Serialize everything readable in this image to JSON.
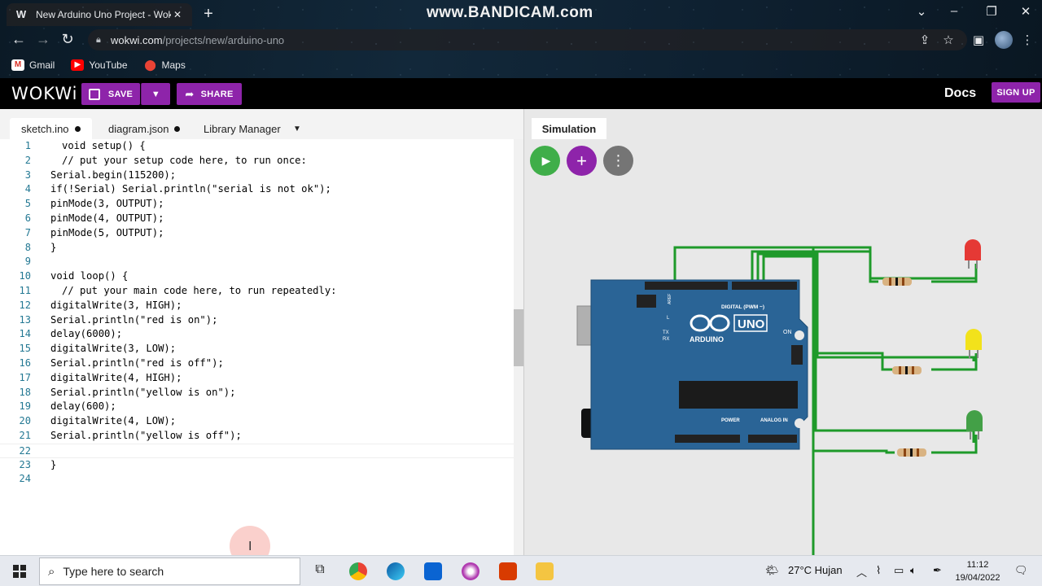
{
  "browser": {
    "tab_title": "New Arduino Uno Project - Wokwi",
    "tab_favicon": "W",
    "url_host": "wokwi.com",
    "url_path": "/projects/new/arduino-uno",
    "watermark": "www.BANDICAM.com",
    "bookmarks": [
      {
        "label": "Gmail",
        "icon": "gmail-icon",
        "color": "#d93025"
      },
      {
        "label": "YouTube",
        "icon": "youtube-icon",
        "color": "#ff0000"
      },
      {
        "label": "Maps",
        "icon": "maps-icon",
        "color": "#34a853"
      }
    ]
  },
  "wokwi": {
    "logo": "WOKWi",
    "save_label": "SAVE",
    "share_label": "SHARE",
    "docs_label": "Docs",
    "signup_label": "SIGN UP",
    "accent": "#8e24aa"
  },
  "editor": {
    "tabs": [
      {
        "label": "sketch.ino",
        "modified": true
      },
      {
        "label": "diagram.json",
        "modified": true
      },
      {
        "label": "Library Manager"
      }
    ],
    "lines": [
      {
        "n": "1",
        "text": "void setup() {",
        "indent": true
      },
      {
        "n": "2",
        "text": "// put your setup code here, to run once:",
        "indent": true
      },
      {
        "n": "3",
        "text": "Serial.begin(115200);"
      },
      {
        "n": "4",
        "text": "if(!Serial) Serial.println(\"serial is not ok\");"
      },
      {
        "n": "5",
        "text": "pinMode(3, OUTPUT);"
      },
      {
        "n": "6",
        "text": "pinMode(4, OUTPUT);"
      },
      {
        "n": "7",
        "text": "pinMode(5, OUTPUT);"
      },
      {
        "n": "8",
        "text": "}"
      },
      {
        "n": "9",
        "text": ""
      },
      {
        "n": "10",
        "text": "void loop() {"
      },
      {
        "n": "11",
        "text": "// put your main code here, to run repeatedly:",
        "indent": true
      },
      {
        "n": "12",
        "text": "digitalWrite(3, HIGH);"
      },
      {
        "n": "13",
        "text": "Serial.println(\"red is on\");"
      },
      {
        "n": "14",
        "text": "delay(6000);"
      },
      {
        "n": "15",
        "text": "digitalWrite(3, LOW);"
      },
      {
        "n": "16",
        "text": "Serial.println(\"red is off\");"
      },
      {
        "n": "17",
        "text": "digitalWrite(4, HIGH);"
      },
      {
        "n": "18",
        "text": "Serial.println(\"yellow is on\");"
      },
      {
        "n": "19",
        "text": "delay(600);"
      },
      {
        "n": "20",
        "text": "digitalWrite(4, LOW);"
      },
      {
        "n": "21",
        "text": "Serial.println(\"yellow is off\");"
      },
      {
        "n": "22",
        "text": "",
        "current": true
      },
      {
        "n": "23",
        "text": "}"
      },
      {
        "n": "24",
        "text": ""
      }
    ]
  },
  "simulation": {
    "tab_label": "Simulation",
    "board": {
      "brand": "ARDUINO",
      "model": "UNO",
      "on_label": "ON",
      "digital_label": "DIGITAL (PWM ~)",
      "analog_label": "ANALOG IN",
      "power_label": "POWER",
      "l_label": "L",
      "tx_label": "TX",
      "rx_label": "RX",
      "aref_label": "AREF"
    },
    "led_colors": [
      "#e53935",
      "#f2e21b",
      "#43a047"
    ],
    "wire_color": "#1e9a2a"
  },
  "taskbar": {
    "search_placeholder": "Type here to search",
    "weather": "27°C  Hujan",
    "time": "11:12",
    "date": "19/04/2022"
  }
}
